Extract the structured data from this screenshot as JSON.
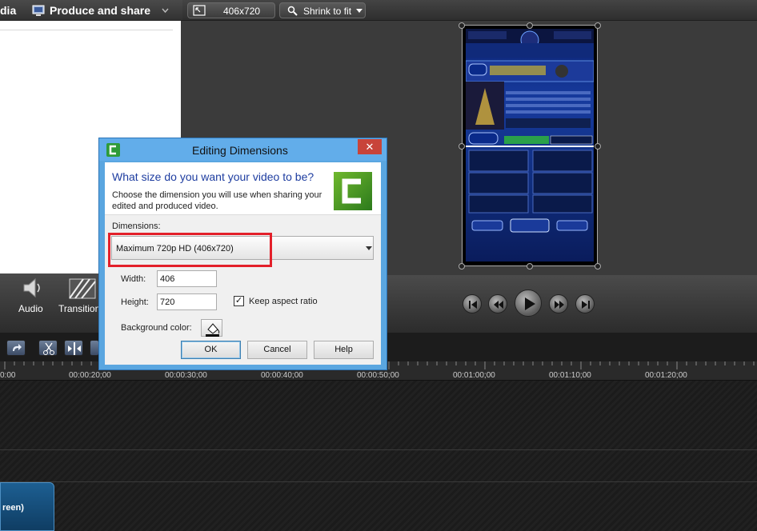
{
  "left_panel": {
    "tab_media_fragment": "dia",
    "tab_produce": "Produce and share"
  },
  "preview_toolbar": {
    "dimensions": "406x720",
    "zoom": "Shrink to fit"
  },
  "tools": {
    "audio_label": "Audio",
    "transitions_label": "Transition"
  },
  "timeline": {
    "ticks": [
      "0:00",
      "00:00:20;00",
      "00:00:30;00",
      "00:00:40;00",
      "00:00:50;00",
      "00:01:00;00",
      "00:01:10;00",
      "00:01:20;00"
    ],
    "clip_label": "reen)"
  },
  "dialog": {
    "title": "Editing Dimensions",
    "close": "✕",
    "question": "What size do you want your video to be?",
    "description": "Choose the dimension you will use when sharing your edited and produced video.",
    "dimensions_label": "Dimensions:",
    "dimensions_value": "Maximum 720p HD (406x720)",
    "width_label": "Width:",
    "width_value": "406",
    "height_label": "Height:",
    "height_value": "720",
    "keep_aspect_label": "Keep aspect ratio",
    "keep_aspect_checked": "✓",
    "bg_color_label": "Background color:",
    "ok": "OK",
    "cancel": "Cancel",
    "help": "Help"
  },
  "colors": {
    "accent": "#5aa6e0",
    "highlight": "#e3202a",
    "clip": "#1d5f92"
  }
}
